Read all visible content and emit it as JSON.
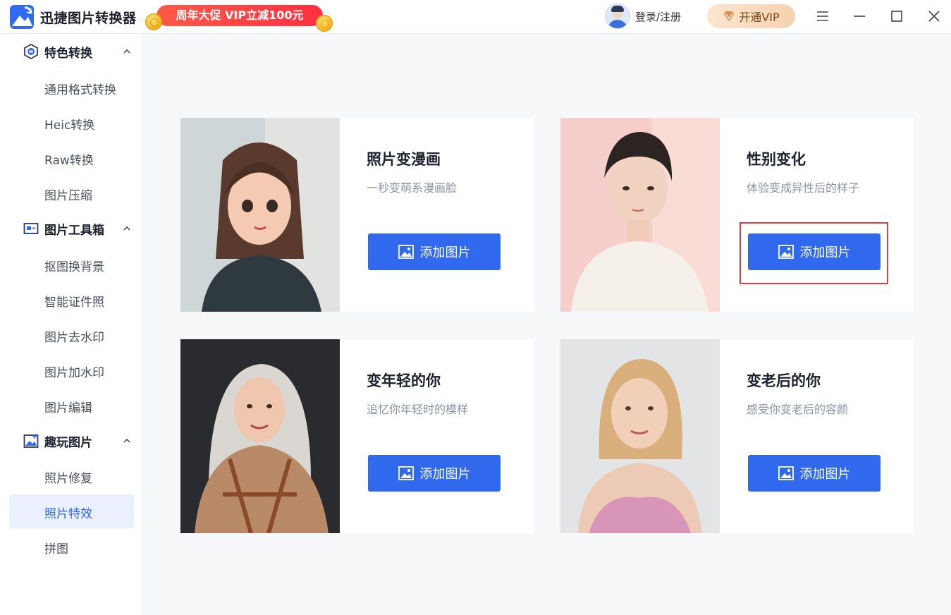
{
  "app": {
    "title": "迅捷图片转换器"
  },
  "promo": {
    "text": "周年大促 VIP立减100元"
  },
  "header": {
    "login_label": "登录/注册",
    "vip_label": "开通VIP"
  },
  "sidebar": {
    "sections": [
      {
        "label": "特色转换",
        "items": [
          "通用格式转换",
          "Heic转换",
          "Raw转换",
          "图片压缩"
        ]
      },
      {
        "label": "图片工具箱",
        "items": [
          "抠图换背景",
          "智能证件照",
          "图片去水印",
          "图片加水印",
          "图片编辑"
        ]
      },
      {
        "label": "趣玩图片",
        "items": [
          "照片修复",
          "照片特效",
          "拼图"
        ]
      }
    ],
    "active_item": "照片特效"
  },
  "cards": [
    {
      "title": "照片变漫画",
      "desc": "一秒变萌系漫画脸",
      "button": "添加图片"
    },
    {
      "title": "性别变化",
      "desc": "体验变成异性后的样子",
      "button": "添加图片"
    },
    {
      "title": "变年轻的你",
      "desc": "追忆你年轻时的模样",
      "button": "添加图片"
    },
    {
      "title": "变老后的你",
      "desc": "感受你变老后的容颜",
      "button": "添加图片"
    }
  ],
  "colors": {
    "accent": "#3169ee",
    "highlight": "#e23c3c",
    "promo": "#ff3b45"
  }
}
